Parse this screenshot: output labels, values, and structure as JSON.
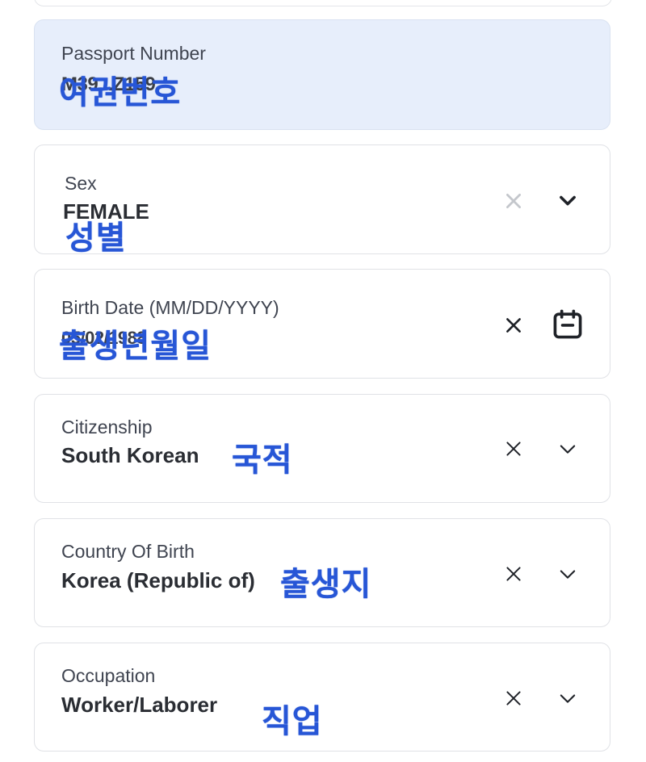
{
  "fields": [
    {
      "label": "Passport Number",
      "value": "M39...Z159",
      "annotation": "여권번호"
    },
    {
      "label": "Sex",
      "value": "FEMALE",
      "annotation": "성별"
    },
    {
      "label": "Birth Date (MM/DD/YYYY)",
      "value": "05/02/1988",
      "annotation": "출생년월일"
    },
    {
      "label": "Citizenship",
      "value": "South Korean",
      "annotation": "국적"
    },
    {
      "label": "Country Of Birth",
      "value": "Korea (Republic of)",
      "annotation": "출생지"
    },
    {
      "label": "Occupation",
      "value": "Worker/Laborer",
      "annotation": "직업"
    }
  ],
  "icons": {
    "clear": "close-icon",
    "dropdown": "chevron-down-icon",
    "calendar": "calendar-icon"
  },
  "colors": {
    "annotation": "#2756d6",
    "highlight_background": "#e7eefb",
    "disabled_clear_icon": "#c4c7cc"
  }
}
